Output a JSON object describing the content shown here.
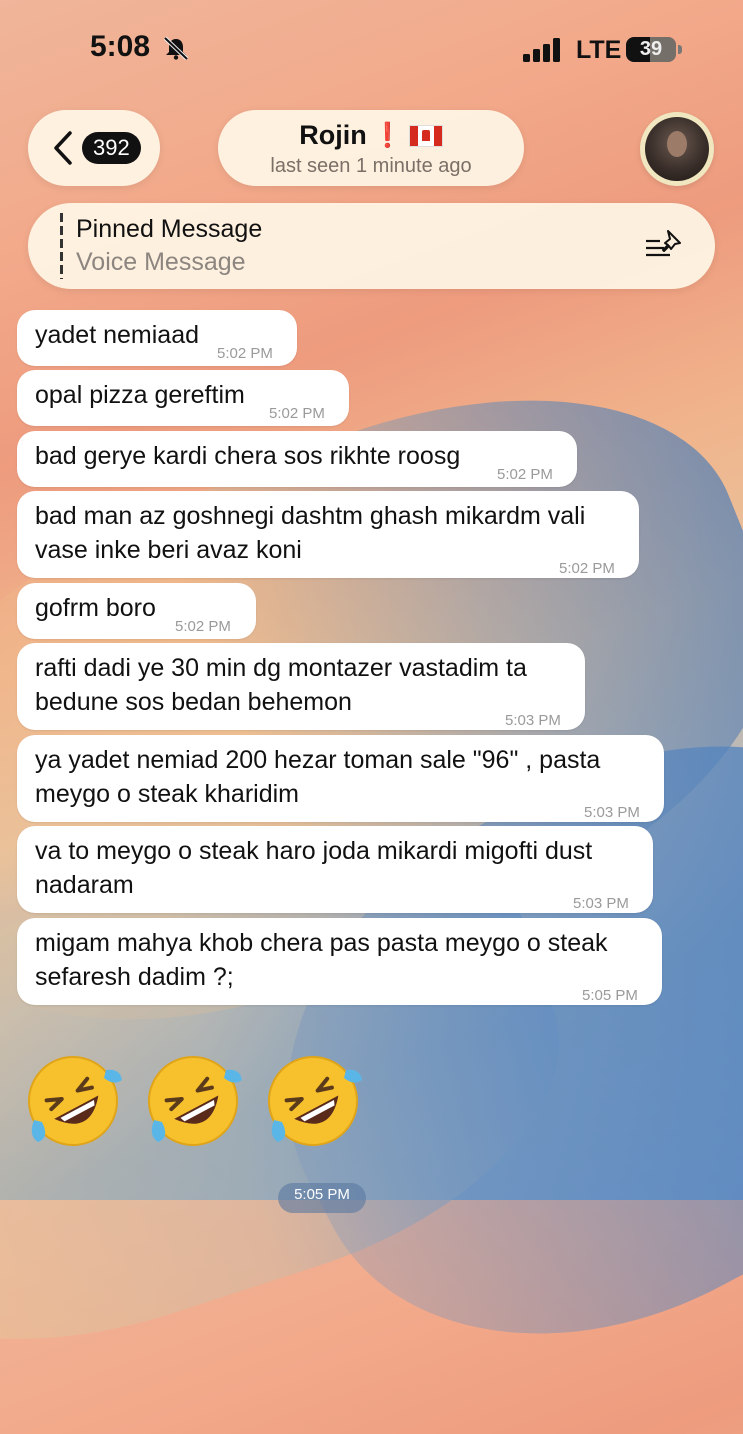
{
  "status_bar": {
    "time": "5:08",
    "network": "LTE",
    "battery": "39"
  },
  "header": {
    "back_count": "392",
    "contact_name": "Rojin",
    "contact_emoji": "❗",
    "contact_flag": "canada-flag",
    "last_seen": "last seen 1 minute ago"
  },
  "pinned": {
    "title": "Pinned Message",
    "subtitle": "Voice Message"
  },
  "messages": [
    {
      "text": "yadet nemiaad",
      "time": "5:02 PM"
    },
    {
      "text": "opal pizza gereftim",
      "time": "5:02 PM"
    },
    {
      "text": "bad gerye kardi chera sos rikhte roosg",
      "time": "5:02 PM"
    },
    {
      "line1": "bad man az goshnegi dashtm ghash mikardm vali",
      "line2": "vase inke beri avaz koni",
      "time": "5:02 PM"
    },
    {
      "text": "gofrm boro",
      "time": "5:02 PM"
    },
    {
      "line1": "rafti dadi ye 30 min dg montazer vastadim ta",
      "line2": "bedune sos bedan behemon",
      "time": "5:03 PM"
    },
    {
      "line1": "ya yadet nemiad 200 hezar toman sale \"96\" , pasta",
      "line2": "meygo o steak kharidim",
      "time": "5:03 PM"
    },
    {
      "line1": "va to meygo o steak haro joda mikardi migofti dust",
      "line2": "nadaram",
      "time": "5:03 PM"
    },
    {
      "line1": "migam mahya khob chera pas pasta meygo o steak",
      "line2": "sefaresh dadim ?;",
      "time": "5:05 PM"
    }
  ],
  "emoji_message": {
    "emojis": [
      "rolling-on-floor-laughing",
      "rolling-on-floor-laughing",
      "rolling-on-floor-laughing"
    ],
    "time": "5:05 PM"
  }
}
